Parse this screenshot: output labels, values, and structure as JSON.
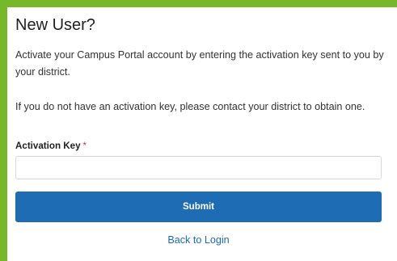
{
  "form": {
    "title": "New User?",
    "description_1": "Activate your Campus Portal account by entering the activation key sent to you by your district.",
    "description_2": "If you do not have an activation key, please contact your district to obtain one.",
    "field_label": "Activation Key",
    "required_marker": "*",
    "activation_key_value": "",
    "activation_key_placeholder": "",
    "submit_label": "Submit",
    "back_link_label": "Back to Login"
  },
  "colors": {
    "border_accent": "#76b82a",
    "primary": "#1e6cb4",
    "required": "#d23c3c"
  }
}
